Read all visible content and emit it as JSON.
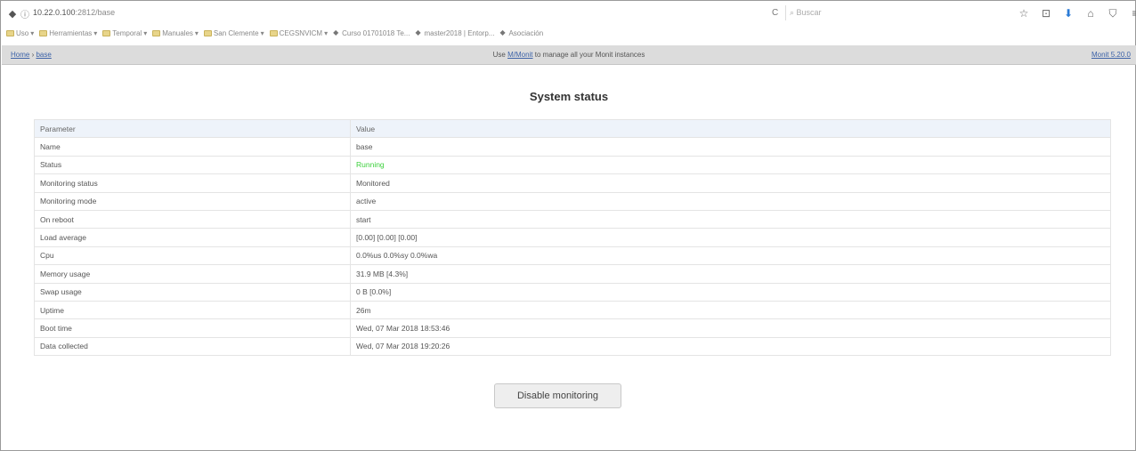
{
  "browser": {
    "url_host": "10.22.0.100",
    "url_rest": ":2812/base",
    "search_placeholder": "Buscar",
    "back_glyph": "◆",
    "info_glyph": "ⓘ",
    "reload_glyph": "C"
  },
  "bookmarks": [
    {
      "label": "Uso",
      "type": "folder"
    },
    {
      "label": "Herramientas",
      "type": "folder"
    },
    {
      "label": "Temporal",
      "type": "folder"
    },
    {
      "label": "Manuales",
      "type": "folder"
    },
    {
      "label": "San Clemente",
      "type": "folder"
    },
    {
      "label": "CEGSNVICM",
      "type": "folder"
    },
    {
      "label": "Curso 01701018 Te...",
      "type": "link"
    },
    {
      "label": "master2018 | Entorp...",
      "type": "link"
    },
    {
      "label": "Asociación",
      "type": "link"
    }
  ],
  "monit_bar": {
    "crumb_home": "Home",
    "crumb_sep": " › ",
    "crumb_current": "base",
    "msg_prefix": "Use ",
    "msg_link": "M/Monit",
    "msg_suffix": " to manage all your Monit instances",
    "version": "Monit 5.20.0"
  },
  "page": {
    "title": "System status"
  },
  "table": {
    "header": [
      "Parameter",
      "Value"
    ],
    "rows": [
      {
        "param": "Name",
        "value": "base"
      },
      {
        "param": "Status",
        "value": "Running"
      },
      {
        "param": "Monitoring status",
        "value": "Monitored"
      },
      {
        "param": "Monitoring mode",
        "value": "active"
      },
      {
        "param": "On reboot",
        "value": "start"
      },
      {
        "param": "Load average",
        "value": "[0.00] [0.00] [0.00]"
      },
      {
        "param": "Cpu",
        "value": "0.0%us 0.0%sy 0.0%wa"
      },
      {
        "param": "Memory usage",
        "value": "31.9 MB [4.3%]"
      },
      {
        "param": "Swap usage",
        "value": "0 B [0.0%]"
      },
      {
        "param": "Uptime",
        "value": "26m"
      },
      {
        "param": "Boot time",
        "value": "Wed, 07 Mar 2018 18:53:46"
      },
      {
        "param": "Data collected",
        "value": "Wed, 07 Mar 2018 19:20:26"
      }
    ]
  },
  "actions": {
    "disable_monitoring": "Disable monitoring"
  },
  "colors": {
    "running": "#3cd03c",
    "header_bg": "#eef3fa",
    "bar_bg": "#dcdcdc",
    "link": "#3d63a8"
  }
}
